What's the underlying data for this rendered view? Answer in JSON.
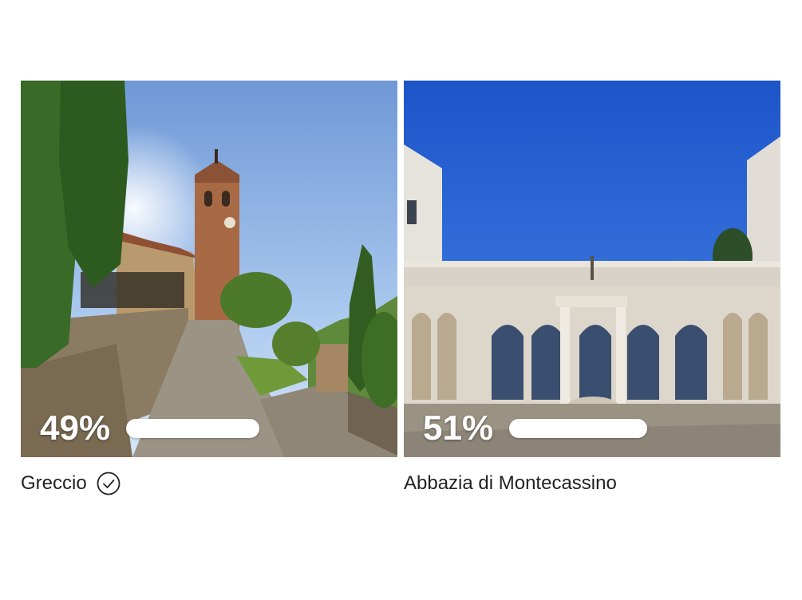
{
  "options": [
    {
      "name": "Greccio",
      "percent_label": "49%",
      "percent": 49,
      "selected": true,
      "icon": "check-circle-icon"
    },
    {
      "name": "Abbazia di Montecassino",
      "percent_label": "51%",
      "percent": 51,
      "selected": false
    }
  ]
}
